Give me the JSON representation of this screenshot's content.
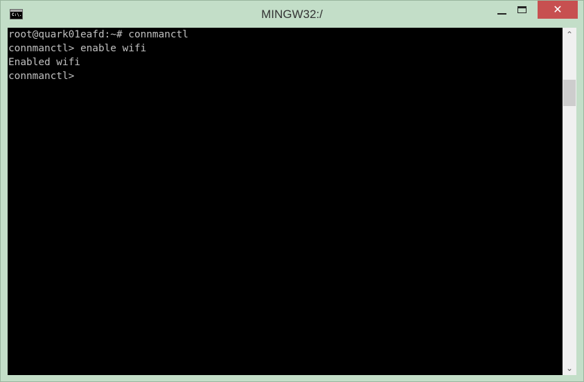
{
  "window": {
    "title": "MINGW32:/",
    "icon": "console-icon",
    "icon_text": "C:\\."
  },
  "controls": {
    "minimize": "minimize-icon",
    "maximize": "maximize-icon",
    "close_glyph": "✕"
  },
  "terminal": {
    "lines": [
      "root@quark01eafd:~# connmanctl",
      "connmanctl> enable wifi",
      "Enabled wifi",
      "connmanctl>"
    ]
  },
  "scrollbar": {
    "up_glyph": "⌃",
    "down_glyph": "⌄"
  },
  "colors": {
    "frame": "#c3dec8",
    "close": "#c75050",
    "terminal_bg": "#000000",
    "terminal_fg": "#c0c0c0"
  }
}
